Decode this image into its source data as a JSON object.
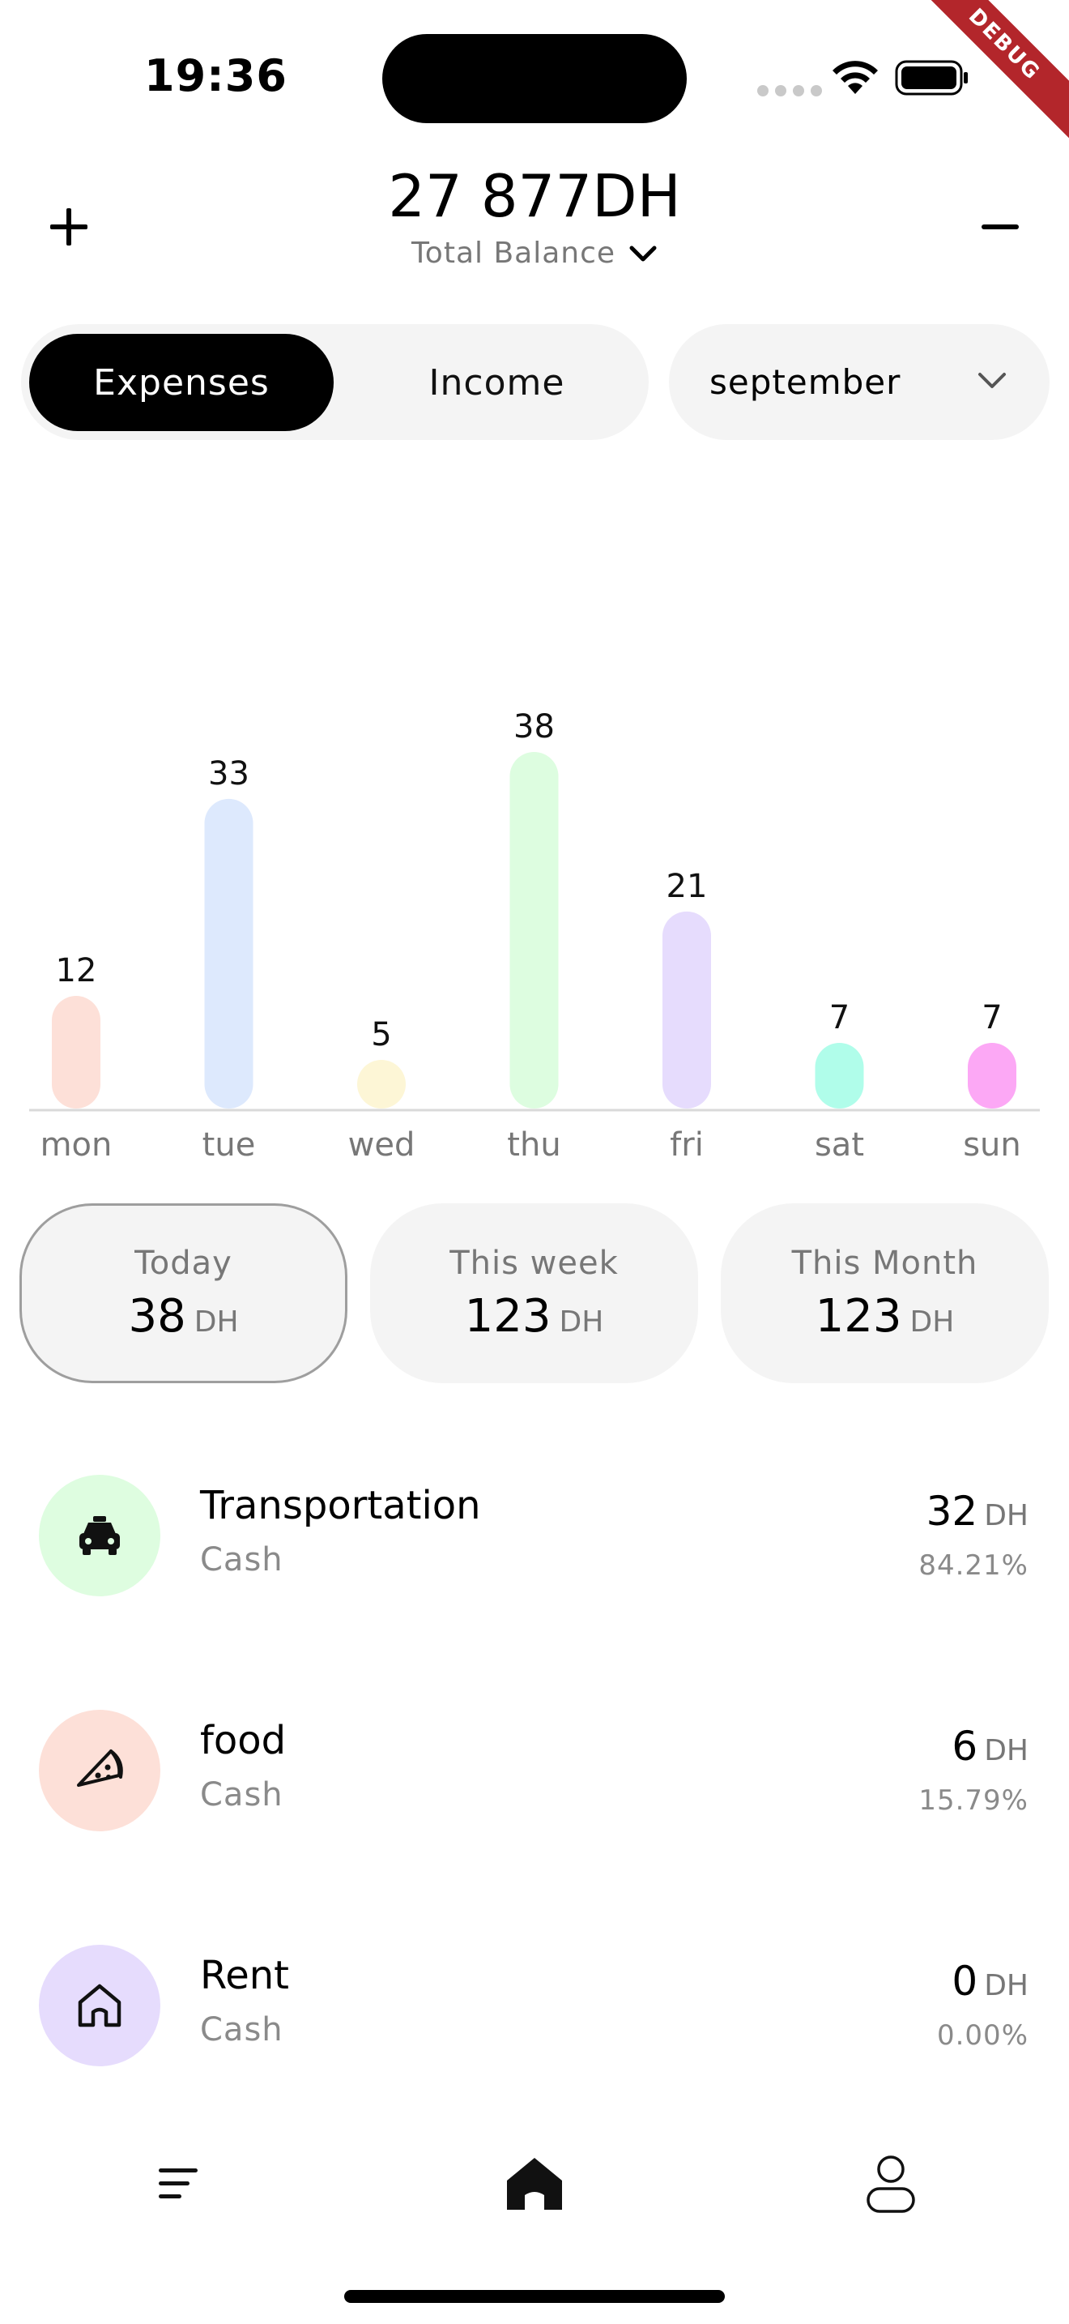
{
  "status_bar": {
    "time": "19:36",
    "debug_label": "DEBUG"
  },
  "header": {
    "balance": "27 877DH",
    "balance_label": "Total Balance",
    "add_icon": "plus-icon",
    "subtract_icon": "minus-icon"
  },
  "toggle": {
    "active": "Expenses",
    "inactive": "Income"
  },
  "month_selector": {
    "value": "september"
  },
  "chart_data": {
    "type": "bar",
    "categories": [
      "mon",
      "tue",
      "wed",
      "thu",
      "fri",
      "sat",
      "sun"
    ],
    "values": [
      12,
      33,
      5,
      38,
      21,
      7,
      7
    ],
    "colors": [
      "#fde0d8",
      "#dde9fd",
      "#fdf6d6",
      "#ddfde0",
      "#e6dcfd",
      "#b0fdea",
      "#fca8f5"
    ],
    "title": "",
    "xlabel": "",
    "ylabel": "",
    "ylim": [
      0,
      38
    ],
    "grid": false
  },
  "summary": [
    {
      "title": "Today",
      "value": "38",
      "unit": "DH"
    },
    {
      "title": "This week",
      "value": "123",
      "unit": "DH"
    },
    {
      "title": "This Month",
      "value": "123",
      "unit": "DH"
    }
  ],
  "categories": [
    {
      "name": "Transportation",
      "account": "Cash",
      "amount": "32",
      "unit": "DH",
      "percent": "84.21%",
      "icon": "taxi-icon",
      "color": "#defde0"
    },
    {
      "name": "food",
      "account": "Cash",
      "amount": "6",
      "unit": "DH",
      "percent": "15.79%",
      "icon": "pizza-icon",
      "color": "#fde0d8"
    },
    {
      "name": "Rent",
      "account": "Cash",
      "amount": "0",
      "unit": "DH",
      "percent": "0.00%",
      "icon": "house-icon",
      "color": "#e6dcfd"
    }
  ],
  "nav": {
    "items": [
      "menu-icon",
      "home-icon",
      "profile-icon"
    ]
  }
}
